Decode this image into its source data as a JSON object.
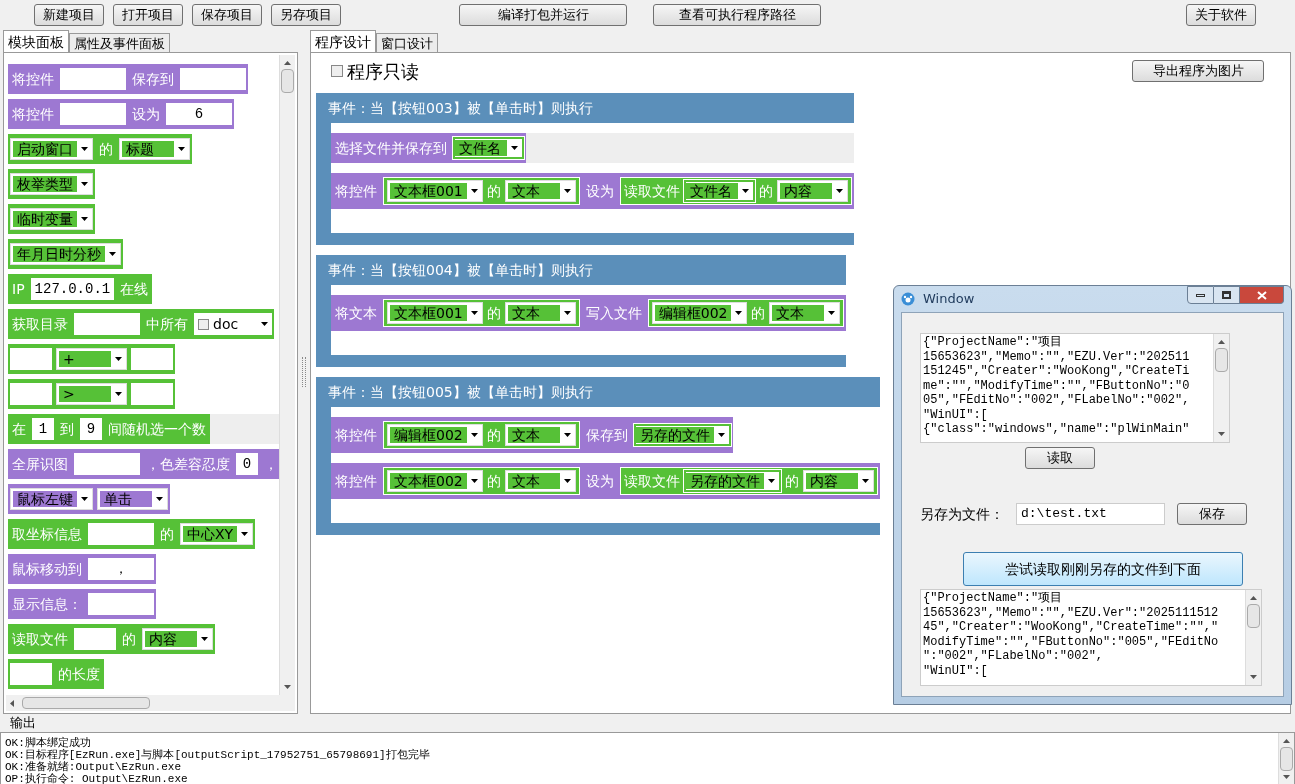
{
  "toolbar": {
    "left": [
      "新建项目",
      "打开项目",
      "保存项目",
      "另存项目"
    ],
    "center": [
      "编译打包并运行",
      "查看可执行程序路径"
    ],
    "right": [
      "关于软件"
    ]
  },
  "left_panel": {
    "tabs": [
      {
        "label": "模块面板",
        "selected": true
      },
      {
        "label": "属性及事件面板",
        "selected": false
      }
    ],
    "blocks": [
      {
        "color": "#9d78d2",
        "parts": [
          {
            "kind": "text",
            "text": "将控件"
          },
          {
            "kind": "input"
          },
          {
            "kind": "text",
            "text": "保存到"
          },
          {
            "kind": "input"
          }
        ]
      },
      {
        "color": "#9d78d2",
        "parts": [
          {
            "kind": "text",
            "text": "将控件"
          },
          {
            "kind": "input"
          },
          {
            "kind": "text",
            "text": "设为"
          },
          {
            "kind": "input",
            "value": "6"
          }
        ]
      },
      {
        "color": "#56c137",
        "parts": [
          {
            "kind": "select",
            "value": "启动窗口"
          },
          {
            "kind": "text",
            "text": "的"
          },
          {
            "kind": "select",
            "value": "标题"
          }
        ]
      },
      {
        "color": "#56c137",
        "parts": [
          {
            "kind": "select",
            "value": "枚举类型"
          }
        ]
      },
      {
        "color": "#56c137",
        "parts": [
          {
            "kind": "select",
            "value": "临时变量"
          }
        ]
      },
      {
        "color": "#56c137",
        "parts": [
          {
            "kind": "select",
            "value": "年月日时分秒"
          }
        ]
      },
      {
        "color": "#56c137",
        "parts": [
          {
            "kind": "text",
            "text": "IP"
          },
          {
            "kind": "input",
            "value": "127.0.0.1"
          },
          {
            "kind": "text",
            "text": "在线"
          }
        ]
      },
      {
        "color": "#56c137",
        "parts": [
          {
            "kind": "text",
            "text": "获取目录"
          },
          {
            "kind": "input"
          },
          {
            "kind": "text",
            "text": "中所有"
          },
          {
            "kind": "check-select",
            "value": "doc",
            "checked": false
          }
        ]
      },
      {
        "color": "#56c137",
        "parts": [
          {
            "kind": "small-input"
          },
          {
            "kind": "select",
            "value": "+"
          },
          {
            "kind": "small-input"
          }
        ]
      },
      {
        "color": "#56c137",
        "parts": [
          {
            "kind": "small-input"
          },
          {
            "kind": "select",
            "value": ">"
          },
          {
            "kind": "small-input"
          }
        ]
      },
      {
        "color": "#56c137",
        "highlighted": true,
        "parts": [
          {
            "kind": "text",
            "text": "在"
          },
          {
            "kind": "tiny-input",
            "value": "1"
          },
          {
            "kind": "text",
            "text": "到"
          },
          {
            "kind": "tiny-input",
            "value": "9"
          },
          {
            "kind": "text",
            "text": "间随机选一个数"
          }
        ]
      },
      {
        "color": "#9d78d2",
        "parts": [
          {
            "kind": "text",
            "text": "全屏识图"
          },
          {
            "kind": "input"
          },
          {
            "kind": "text",
            "text": "，色差容忍度"
          },
          {
            "kind": "tiny-input",
            "value": "0"
          },
          {
            "kind": "text",
            "text": "，"
          }
        ]
      },
      {
        "color": "#9d78d2",
        "parts": [
          {
            "kind": "select",
            "value": "鼠标左键"
          },
          {
            "kind": "select",
            "value": "单击"
          }
        ]
      },
      {
        "color": "#56c137",
        "parts": [
          {
            "kind": "text",
            "text": "取坐标信息"
          },
          {
            "kind": "input"
          },
          {
            "kind": "text",
            "text": "的"
          },
          {
            "kind": "select",
            "value": "中心XY"
          }
        ]
      },
      {
        "color": "#9d78d2",
        "parts": [
          {
            "kind": "text",
            "text": "鼠标移动到"
          },
          {
            "kind": "input",
            "value": "，"
          }
        ]
      },
      {
        "color": "#9d78d2",
        "parts": [
          {
            "kind": "text",
            "text": "显示信息："
          },
          {
            "kind": "input"
          }
        ]
      },
      {
        "color": "#56c137",
        "parts": [
          {
            "kind": "text",
            "text": "读取文件"
          },
          {
            "kind": "small-input"
          },
          {
            "kind": "text",
            "text": "的"
          },
          {
            "kind": "select",
            "value": "内容"
          }
        ]
      },
      {
        "color": "#56c137",
        "parts": [
          {
            "kind": "small-input"
          },
          {
            "kind": "text",
            "text": "的长度"
          }
        ]
      }
    ]
  },
  "editor": {
    "tabs": [
      {
        "label": "程序设计",
        "selected": true
      },
      {
        "label": "窗口设计",
        "selected": false
      }
    ],
    "read_only": {
      "label": "程序只读",
      "checked": false
    },
    "export_button": "导出程序为图片",
    "events": [
      {
        "title": "事件：当【按钮003】被【单击时】则执行",
        "rows": [
          {
            "color": "#9d78d2",
            "highlighted": true,
            "parts": [
              {
                "kind": "text",
                "text": "选择文件并保存到"
              },
              {
                "kind": "select",
                "value": "文件名"
              }
            ]
          },
          {
            "color": "#9d78d2",
            "parts": [
              {
                "kind": "text",
                "text": "将控件"
              },
              {
                "kind": "pair",
                "value": "文本框001",
                "middle": "的",
                "prop": "文本"
              },
              {
                "kind": "text",
                "text": "设为"
              },
              {
                "kind": "group",
                "text": "读取文件",
                "value": "文件名",
                "middle": "的",
                "prop": "内容"
              }
            ]
          }
        ]
      },
      {
        "title": "事件：当【按钮004】被【单击时】则执行",
        "rows": [
          {
            "color": "#9d78d2",
            "parts": [
              {
                "kind": "text",
                "text": "将文本"
              },
              {
                "kind": "pair",
                "value": "文本框001",
                "middle": "的",
                "prop": "文本"
              },
              {
                "kind": "text",
                "text": "写入文件"
              },
              {
                "kind": "pair",
                "value": "编辑框002",
                "middle": "的",
                "prop": "文本"
              }
            ]
          }
        ]
      },
      {
        "title": "事件：当【按钮005】被【单击时】则执行",
        "rows": [
          {
            "color": "#9d78d2",
            "parts": [
              {
                "kind": "text",
                "text": "将控件"
              },
              {
                "kind": "pair",
                "value": "编辑框002",
                "middle": "的",
                "prop": "文本"
              },
              {
                "kind": "text",
                "text": "保存到"
              },
              {
                "kind": "select",
                "value": "另存的文件"
              }
            ]
          },
          {
            "color": "#9d78d2",
            "parts": [
              {
                "kind": "text",
                "text": "将控件"
              },
              {
                "kind": "pair",
                "value": "文本框002",
                "middle": "的",
                "prop": "文本"
              },
              {
                "kind": "text",
                "text": "设为"
              },
              {
                "kind": "group",
                "text": "读取文件",
                "value": "另存的文件",
                "middle": "的",
                "prop": "内容"
              }
            ]
          }
        ]
      }
    ]
  },
  "dialog": {
    "title": "Window",
    "text_1": [
      "{\"ProjectName\":\"项目",
      "15653623\",\"Memo\":\"\",\"EZU.Ver\":\"202511",
      "151245\",\"Creater\":\"WooKong\",\"CreateTi",
      "me\":\"\",\"ModifyTime\":\"\",\"FButtonNo\":\"0",
      "05\",\"FEditNo\":\"002\",\"FLabelNo\":\"002\",",
      "\"WinUI\":[",
      "{\"class\":\"windows\",\"name\":\"plWinMain\""
    ],
    "read_button": "读取",
    "save_label": "另存为文件：",
    "save_path": "d:\\test.txt",
    "save_button": "保存",
    "try_button": "尝试读取刚刚另存的文件到下面",
    "text_2": [
      "{\"ProjectName\":\"项目",
      "15653623\",\"Memo\":\"\",\"EZU.Ver\":\"2025111512",
      "45\",\"Creater\":\"WooKong\",\"CreateTime\":\"\",\"",
      "ModifyTime\":\"\",\"FButtonNo\":\"005\",\"FEditNo",
      "\":\"002\",\"FLabelNo\":\"002\",",
      "\"WinUI\":["
    ]
  },
  "output": {
    "title": "输出",
    "lines": [
      "OK:脚本绑定成功",
      "OK:目标程序[EzRun.exe]与脚本[outputScript_17952751_65798691]打包完毕",
      "OK:准备就绪:Output\\EzRun.exe",
      "OP:执行命令: Output\\EzRun.exe"
    ]
  }
}
